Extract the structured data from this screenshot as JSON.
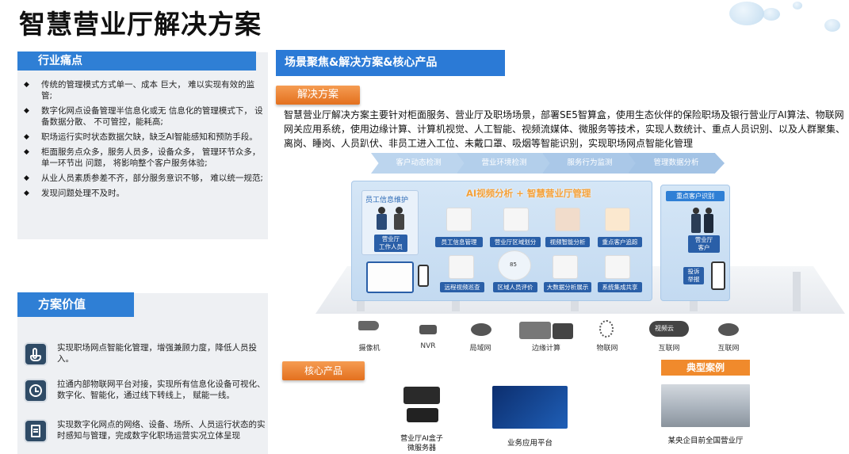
{
  "title": "智慧营业厅解决方案",
  "left": {
    "pain_header": "行业痛点",
    "pain_points": [
      "传统的管理模式方式单一、成本 巨大， 难以实现有效的监管;",
      "数字化网点设备管理半信息化或无 信息化的管理模式下， 设备数据分散、 不可管控，能耗高;",
      "职场运行实时状态数据欠缺，缺乏AI智能感知和预防手段。",
      "柜面服务点众多，服务人员多，设备众多， 管理环节众多， 单一环节出 问题， 将影响整个客户服务体验;",
      "从业人员素质参差不齐，部分服务意识不够， 难以统一规范;",
      "发现问题处理不及时。"
    ],
    "value_header": "方案价值",
    "values": [
      {
        "icon": "touch-icon",
        "text": "实现职场网点智能化管理，增强兼顾力度，降低人员投入。"
      },
      {
        "icon": "clock-icon",
        "text": "拉通内部物联网平台对接，实现所有信息化设备可视化、数字化、智能化，通过线下转线上， 赋能一线。"
      },
      {
        "icon": "document-icon",
        "text": "实现数字化网点的网络、设备、场所、人员运行状态的实时感知与管理，完成数字化职场运营实况立体呈现"
      }
    ]
  },
  "right": {
    "header": "场景聚焦&解决方案&核心产品",
    "solution_tag": "解决方案",
    "description": "智慧营业厅解决方案主要针对柜面服务、营业厅及职场场景，部署SE5智算盒，使用生态伙伴的保险职场及银行营业厅AI算法、物联网网关应用系统，使用边缘计算、计算机视觉、人工智能、视频流媒体、微服务等技术，实现人数统计、重点人员识别、以及人群聚集、离岗、睡岗、人员趴伏、非员工进入工位、未戴口罩、吸烟等智能识别，实现职场网点智能化管理",
    "flow": [
      "客户动态检测",
      "营业环境检测",
      "服务行为监测",
      "管理数据分析"
    ],
    "diagram": {
      "banner": "AI视频分析 + 智慧营业厅管理",
      "staff_box_title": "员工信息维护",
      "staff_caption": "营业厅\n工作人员",
      "modules_row1": [
        "员工信息管理",
        "营业厅区域划分",
        "视频智能分析",
        "重点客户追踪"
      ],
      "modules_row2": [
        "远程视频巡查",
        "区域人员评价",
        "大数据分析展示",
        "系统集成共享"
      ],
      "radar_value": "85",
      "side_title": "重点客户识别",
      "side_caption": "营业厅\n客户",
      "side_report": "投诉\n举报",
      "devices": [
        "摄像机",
        "NVR",
        "局域网",
        "边缘计算",
        "物联网",
        "互联网",
        "互联网"
      ],
      "cloud_label": "视频云"
    },
    "core_tag": "核心产品",
    "case_tag": "典型案例",
    "products": [
      {
        "label": "营业厅AI盒子\n微服务器"
      },
      {
        "label": "业务应用平台"
      },
      {
        "label": "某央企目前全国营业厅"
      }
    ]
  },
  "colors": {
    "blue": "#2f7fd5",
    "orange": "#e3701e",
    "navy": "#2a5fa8"
  }
}
